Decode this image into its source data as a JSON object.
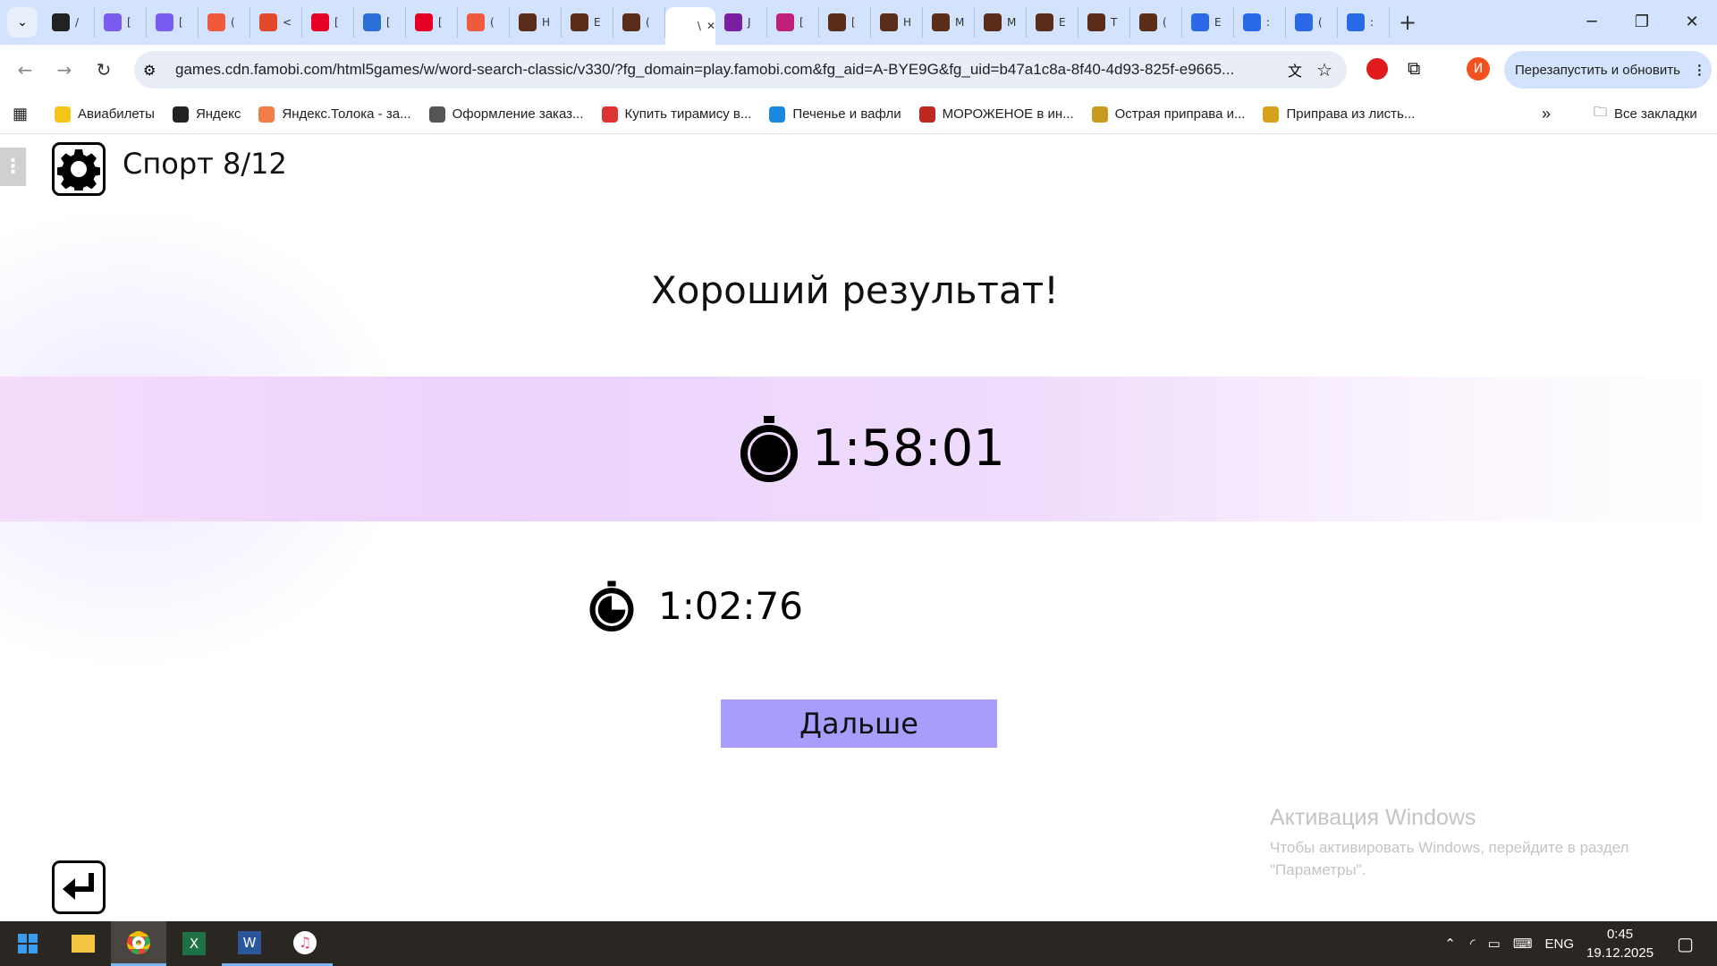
{
  "browser": {
    "tabs": [
      {
        "letter": "/",
        "color": "#222"
      },
      {
        "letter": "[",
        "color": "#7b5cf0"
      },
      {
        "letter": "[",
        "color": "#7b5cf0"
      },
      {
        "letter": "(",
        "color": "#f05a3c"
      },
      {
        "letter": "<",
        "color": "#e24a2a"
      },
      {
        "letter": "[",
        "color": "#e60023"
      },
      {
        "letter": "[",
        "color": "#2b6fd8"
      },
      {
        "letter": "[",
        "color": "#e60023"
      },
      {
        "letter": "(",
        "color": "#f05a3c"
      },
      {
        "letter": "H",
        "color": "#5a2d1a"
      },
      {
        "letter": "E",
        "color": "#5a2d1a"
      },
      {
        "letter": "(",
        "color": "#5a2d1a"
      },
      {
        "letter": "\\",
        "color": "#ffffff",
        "active": true
      },
      {
        "letter": "J",
        "color": "#7a1fa0"
      },
      {
        "letter": "[",
        "color": "#c0207a"
      },
      {
        "letter": "[",
        "color": "#5a2d1a"
      },
      {
        "letter": "H",
        "color": "#5a2d1a"
      },
      {
        "letter": "M",
        "color": "#5a2d1a"
      },
      {
        "letter": "M",
        "color": "#5a2d1a"
      },
      {
        "letter": "E",
        "color": "#5a2d1a"
      },
      {
        "letter": "T",
        "color": "#5a2d1a"
      },
      {
        "letter": "(",
        "color": "#5a2d1a"
      },
      {
        "letter": "E",
        "color": "#2a6ae8"
      },
      {
        "letter": ":",
        "color": "#2a6ae8"
      },
      {
        "letter": "(",
        "color": "#2a6ae8"
      },
      {
        "letter": ":",
        "color": "#2a6ae8"
      }
    ],
    "url": "games.cdn.famobi.com/html5games/w/word-search-classic/v330/?fg_domain=play.famobi.com&fg_aid=A-BYE9G&fg_uid=b47a1c8a-8f40-4d93-825f-e9665...",
    "profile_letter": "И",
    "restart_label": "Перезапустить и обновить",
    "bookmarks": [
      "Авиабилеты",
      "Яндекс",
      "Яндекс.Толока - за...",
      "Оформление заказ...",
      "Купить тирамису в...",
      "Печенье и вафли",
      "МОРОЖЕНОЕ в ин...",
      "Острая приправа и...",
      "Приправа из листь..."
    ],
    "bookmark_colors": [
      "#f5c518",
      "#222",
      "#f47b4a",
      "#555",
      "#d33",
      "#1a8ae0",
      "#c0281e",
      "#c99a1c",
      "#d6a21c"
    ],
    "more": "»",
    "all_bookmarks": "Все закладки"
  },
  "game": {
    "level_title": "Спорт 8/12",
    "result_heading": "Хороший результат!",
    "current_time": "1:58:01",
    "best_time": "1:02:76",
    "next_button": "Дальше",
    "accent": "#a99dfb"
  },
  "watermark": {
    "title": "Активация Windows",
    "line1": "Чтобы активировать Windows, перейдите в раздел",
    "line2": "\"Параметры\"."
  },
  "taskbar": {
    "lang": "ENG",
    "time": "0:45",
    "date": "19.12.2025"
  }
}
